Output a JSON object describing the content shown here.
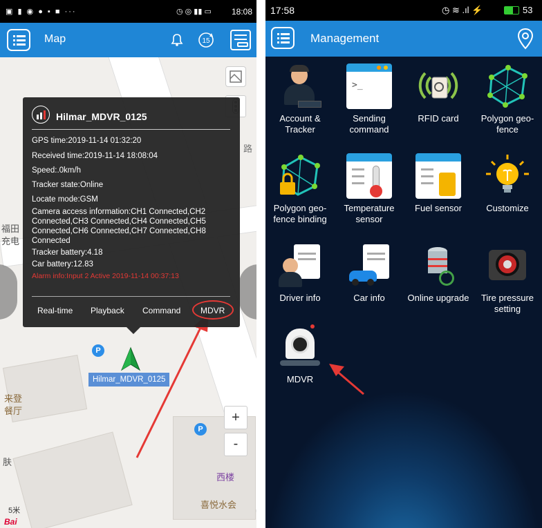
{
  "left": {
    "status": {
      "time": "18:08"
    },
    "appbar": {
      "title": "Map"
    },
    "map": {
      "labels": [
        "来登",
        "餐厅",
        "福田",
        "充电",
        "西楼",
        "喜悦水会",
        "5米",
        "路",
        "肤"
      ],
      "logo": "Bai",
      "marker_label": "Hilmar_MDVR_0125",
      "zoom_in": "+",
      "zoom_out": "-",
      "parking": "P"
    },
    "popup": {
      "title": "Hilmar_MDVR_0125",
      "gps_time": "GPS time:2019-11-14 01:32:20",
      "received_time": "Received time:2019-11-14 18:08:04",
      "speed": "Speed:.0km/h",
      "tracker_state": "Tracker state:Online",
      "locate_mode": "Locate mode:GSM",
      "camera_info": "Camera access information:CH1 Connected,CH2 Connected,CH3 Connected,CH4 Connected,CH5 Connected,CH6 Connected,CH7 Connected,CH8 Connected",
      "tracker_battery": "Tracker battery:4.18",
      "car_battery": "Car battery:12.83",
      "alarm": "Alarm info:Input 2 Active 2019-11-14 00:37:13",
      "buttons": [
        "Real-time",
        "Playback",
        "Command",
        "MDVR"
      ]
    }
  },
  "right": {
    "status": {
      "time": "17:58",
      "battery": "53"
    },
    "appbar": {
      "title": "Management"
    },
    "tiles": [
      {
        "label": "Account & Tracker",
        "icon": "account-tracker-icon"
      },
      {
        "label": "Sending command",
        "icon": "terminal-icon"
      },
      {
        "label": "RFID card",
        "icon": "rfid-card-icon"
      },
      {
        "label": "Polygon geo-fence",
        "icon": "polygon-icon"
      },
      {
        "label": "Polygon geo-fence binding",
        "icon": "polygon-lock-icon"
      },
      {
        "label": "Temperature sensor",
        "icon": "thermometer-icon"
      },
      {
        "label": "Fuel sensor",
        "icon": "fuel-icon"
      },
      {
        "label": "Customize",
        "icon": "lightbulb-icon"
      },
      {
        "label": "Driver info",
        "icon": "driver-icon"
      },
      {
        "label": "Car info",
        "icon": "car-icon"
      },
      {
        "label": "Online upgrade",
        "icon": "database-upgrade-icon"
      },
      {
        "label": "Tire pressure setting",
        "icon": "tire-icon"
      },
      {
        "label": "MDVR",
        "icon": "camera-icon"
      }
    ]
  },
  "colors": {
    "appbar": "#1f86d6",
    "popup": "#262626",
    "highlight": "#e53935",
    "marker": "#1a9b3c"
  }
}
